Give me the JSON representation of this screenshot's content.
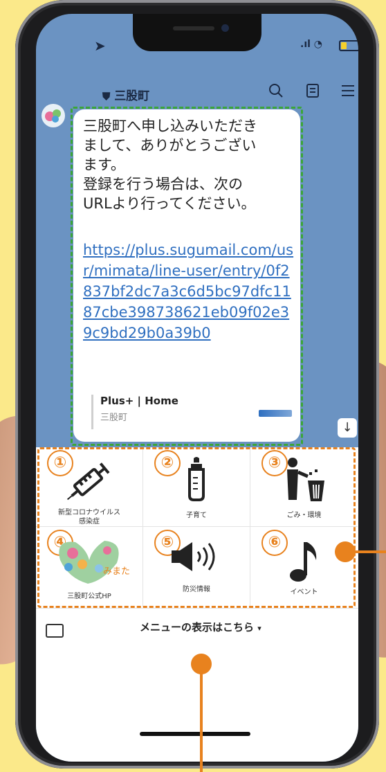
{
  "status": {
    "signal_text": ".ıl",
    "wifi_icon": "wifi-icon",
    "location_icon": "location-arrow-icon"
  },
  "header": {
    "title": "三股町"
  },
  "chat": {
    "message": "三股町へ申し込みいただき\nまして、ありがとうござい\nます。\n登録を行う場合は、次の\nURLより行ってください。",
    "link": "https://plus.sugumail.com/usr/mimata/line-user/entry/0f2837bf2dc7a3c6d5bc97dfc1187cbe398738621eb09f02e39c9bd29b0a39b0",
    "preview_title": "Plus+ | Home",
    "preview_site": "三股町"
  },
  "menu": {
    "items": [
      {
        "num": "①",
        "label": "新型コロナウイルス\n感染症",
        "icon": "syringe-icon"
      },
      {
        "num": "②",
        "label": "子育て",
        "icon": "baby-bottle-icon"
      },
      {
        "num": "③",
        "label": "ごみ・環境",
        "icon": "trash-person-icon"
      },
      {
        "num": "④",
        "label": "三股町公式HP",
        "icon": "town-logo-icon",
        "logo_text": "みまた"
      },
      {
        "num": "⑤",
        "label": "防災情報",
        "icon": "speaker-icon"
      },
      {
        "num": "⑥",
        "label": "イベント",
        "icon": "music-note-icon"
      }
    ],
    "toggle_label": "メニューの表示はこちら",
    "toggle_caret": "▾"
  },
  "colors": {
    "chat_bg": "#6b93c2",
    "accent_orange": "#e8821e",
    "accent_green": "#3ba638",
    "link": "#2f6fc0"
  }
}
